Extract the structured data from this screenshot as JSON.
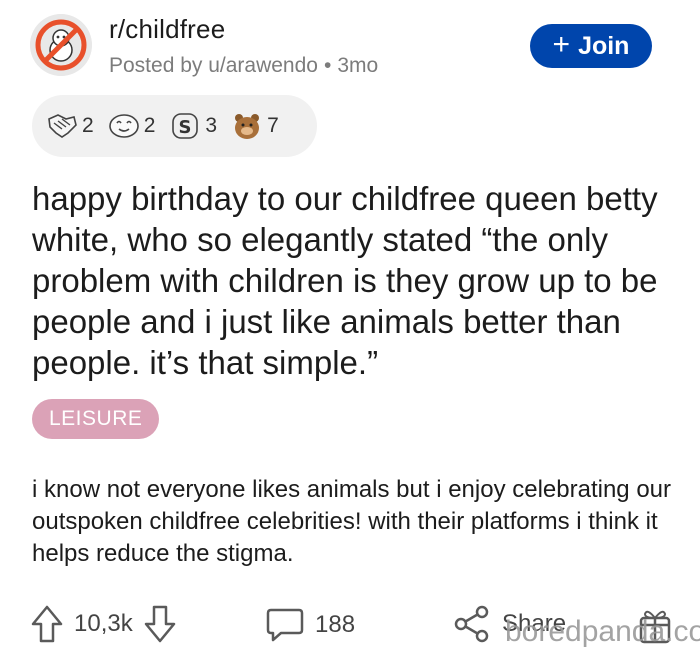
{
  "header": {
    "subreddit": "r/childfree",
    "posted_by": "Posted by u/arawendo",
    "age": "3mo",
    "join_label": "Join"
  },
  "awards": [
    {
      "icon": "handshake-award-icon",
      "count": "2"
    },
    {
      "icon": "wholesome-face-award-icon",
      "count": "2"
    },
    {
      "icon": "silver-s-award-icon",
      "count": "3"
    },
    {
      "icon": "bear-award-icon",
      "count": "7"
    }
  ],
  "post": {
    "title": "happy birthday to our childfree queen betty white, who so elegantly stated “the only problem with children is they grow up to be people and i just like animals better than people. it’s that simple.”",
    "flair": "LEISURE",
    "body": "i know not everyone likes animals but i enjoy celebrating our outspoken childfree celebrities! with their platforms i think it helps reduce the stigma."
  },
  "footer": {
    "upvotes": "10,3k",
    "comments": "188",
    "share_label": "Share"
  },
  "watermark": "boredpanda.com",
  "colors": {
    "join_bg": "#0045ac",
    "flair_bg": "#dba2b7",
    "awards_bg": "#f1f1f1"
  }
}
